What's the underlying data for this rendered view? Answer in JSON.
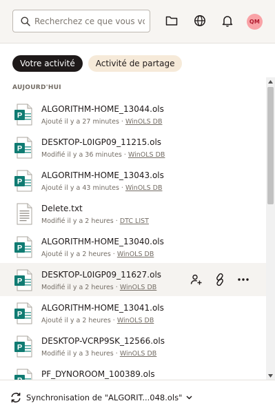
{
  "search": {
    "placeholder": "Recherchez ce que vous vou"
  },
  "header": {
    "avatar_initials": "QM",
    "icons": [
      "folder-icon",
      "globe-icon",
      "bell-icon"
    ]
  },
  "tabs": [
    {
      "label": "Votre activité",
      "active": true
    },
    {
      "label": "Activité de partage",
      "active": false
    }
  ],
  "section_label": "AUJOURD'HUI",
  "files": [
    {
      "name": "ALGORITHM-HOME_13044.ols",
      "meta": "Ajouté il y a 27 minutes · ",
      "location": "WinOLS DB",
      "type": "ols"
    },
    {
      "name": "DESKTOP-L0IGP09_11215.ols",
      "meta": "Modifié il y a 36 minutes · ",
      "location": "WinOLS DB",
      "type": "ols"
    },
    {
      "name": "ALGORITHM-HOME_13043.ols",
      "meta": "Ajouté il y a 43 minutes · ",
      "location": "WinOLS DB",
      "type": "ols"
    },
    {
      "name": "Delete.txt",
      "meta": "Modifié il y a 2 heures · ",
      "location": "DTC LIST",
      "type": "txt"
    },
    {
      "name": "ALGORITHM-HOME_13040.ols",
      "meta": "Ajouté il y a 2 heures · ",
      "location": "WinOLS DB",
      "type": "ols"
    },
    {
      "name": "DESKTOP-L0IGP09_11627.ols",
      "meta": "Modifié il y a 2 heures · ",
      "location": "WinOLS DB",
      "type": "ols",
      "hovered": true
    },
    {
      "name": "ALGORITHM-HOME_13041.ols",
      "meta": "Ajouté il y a 2 heures · ",
      "location": "WinOLS DB",
      "type": "ols"
    },
    {
      "name": "DESKTOP-VCRP9SK_12566.ols",
      "meta": "Modifié il y a 3 heures · ",
      "location": "WinOLS DB",
      "type": "ols"
    },
    {
      "name": "PF_DYNOROOM_100389.ols",
      "meta": "",
      "location": "",
      "type": "ols"
    }
  ],
  "row_actions": [
    "share-user-icon",
    "link-icon",
    "more-icon"
  ],
  "footer": {
    "sync_text": "Synchronisation de \"ALGORIT...048.ols\""
  },
  "colors": {
    "accent": "#1e1919",
    "ols_icon": "#0f7b72",
    "avatar_bg": "#f9a2a6",
    "tab_inactive_bg": "#f6ead9"
  }
}
